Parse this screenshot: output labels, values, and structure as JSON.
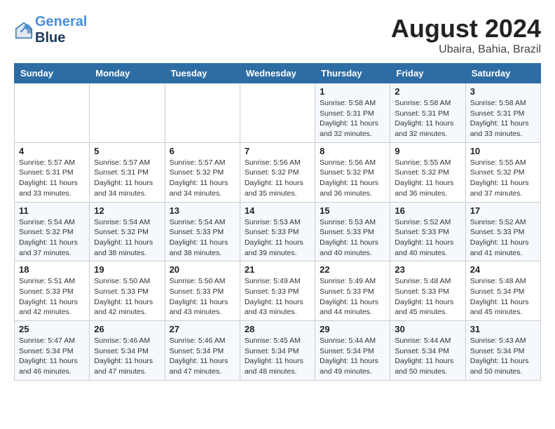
{
  "header": {
    "logo_line1": "General",
    "logo_line2": "Blue",
    "month_year": "August 2024",
    "location": "Ubaira, Bahia, Brazil"
  },
  "days_of_week": [
    "Sunday",
    "Monday",
    "Tuesday",
    "Wednesday",
    "Thursday",
    "Friday",
    "Saturday"
  ],
  "weeks": [
    [
      {
        "day": "",
        "info": ""
      },
      {
        "day": "",
        "info": ""
      },
      {
        "day": "",
        "info": ""
      },
      {
        "day": "",
        "info": ""
      },
      {
        "day": "1",
        "info": "Sunrise: 5:58 AM\nSunset: 5:31 PM\nDaylight: 11 hours and 32 minutes."
      },
      {
        "day": "2",
        "info": "Sunrise: 5:58 AM\nSunset: 5:31 PM\nDaylight: 11 hours and 32 minutes."
      },
      {
        "day": "3",
        "info": "Sunrise: 5:58 AM\nSunset: 5:31 PM\nDaylight: 11 hours and 33 minutes."
      }
    ],
    [
      {
        "day": "4",
        "info": "Sunrise: 5:57 AM\nSunset: 5:31 PM\nDaylight: 11 hours and 33 minutes."
      },
      {
        "day": "5",
        "info": "Sunrise: 5:57 AM\nSunset: 5:31 PM\nDaylight: 11 hours and 34 minutes."
      },
      {
        "day": "6",
        "info": "Sunrise: 5:57 AM\nSunset: 5:32 PM\nDaylight: 11 hours and 34 minutes."
      },
      {
        "day": "7",
        "info": "Sunrise: 5:56 AM\nSunset: 5:32 PM\nDaylight: 11 hours and 35 minutes."
      },
      {
        "day": "8",
        "info": "Sunrise: 5:56 AM\nSunset: 5:32 PM\nDaylight: 11 hours and 36 minutes."
      },
      {
        "day": "9",
        "info": "Sunrise: 5:55 AM\nSunset: 5:32 PM\nDaylight: 11 hours and 36 minutes."
      },
      {
        "day": "10",
        "info": "Sunrise: 5:55 AM\nSunset: 5:32 PM\nDaylight: 11 hours and 37 minutes."
      }
    ],
    [
      {
        "day": "11",
        "info": "Sunrise: 5:54 AM\nSunset: 5:32 PM\nDaylight: 11 hours and 37 minutes."
      },
      {
        "day": "12",
        "info": "Sunrise: 5:54 AM\nSunset: 5:32 PM\nDaylight: 11 hours and 38 minutes."
      },
      {
        "day": "13",
        "info": "Sunrise: 5:54 AM\nSunset: 5:33 PM\nDaylight: 11 hours and 38 minutes."
      },
      {
        "day": "14",
        "info": "Sunrise: 5:53 AM\nSunset: 5:33 PM\nDaylight: 11 hours and 39 minutes."
      },
      {
        "day": "15",
        "info": "Sunrise: 5:53 AM\nSunset: 5:33 PM\nDaylight: 11 hours and 40 minutes."
      },
      {
        "day": "16",
        "info": "Sunrise: 5:52 AM\nSunset: 5:33 PM\nDaylight: 11 hours and 40 minutes."
      },
      {
        "day": "17",
        "info": "Sunrise: 5:52 AM\nSunset: 5:33 PM\nDaylight: 11 hours and 41 minutes."
      }
    ],
    [
      {
        "day": "18",
        "info": "Sunrise: 5:51 AM\nSunset: 5:33 PM\nDaylight: 11 hours and 42 minutes."
      },
      {
        "day": "19",
        "info": "Sunrise: 5:50 AM\nSunset: 5:33 PM\nDaylight: 11 hours and 42 minutes."
      },
      {
        "day": "20",
        "info": "Sunrise: 5:50 AM\nSunset: 5:33 PM\nDaylight: 11 hours and 43 minutes."
      },
      {
        "day": "21",
        "info": "Sunrise: 5:49 AM\nSunset: 5:33 PM\nDaylight: 11 hours and 43 minutes."
      },
      {
        "day": "22",
        "info": "Sunrise: 5:49 AM\nSunset: 5:33 PM\nDaylight: 11 hours and 44 minutes."
      },
      {
        "day": "23",
        "info": "Sunrise: 5:48 AM\nSunset: 5:33 PM\nDaylight: 11 hours and 45 minutes."
      },
      {
        "day": "24",
        "info": "Sunrise: 5:48 AM\nSunset: 5:34 PM\nDaylight: 11 hours and 45 minutes."
      }
    ],
    [
      {
        "day": "25",
        "info": "Sunrise: 5:47 AM\nSunset: 5:34 PM\nDaylight: 11 hours and 46 minutes."
      },
      {
        "day": "26",
        "info": "Sunrise: 5:46 AM\nSunset: 5:34 PM\nDaylight: 11 hours and 47 minutes."
      },
      {
        "day": "27",
        "info": "Sunrise: 5:46 AM\nSunset: 5:34 PM\nDaylight: 11 hours and 47 minutes."
      },
      {
        "day": "28",
        "info": "Sunrise: 5:45 AM\nSunset: 5:34 PM\nDaylight: 11 hours and 48 minutes."
      },
      {
        "day": "29",
        "info": "Sunrise: 5:44 AM\nSunset: 5:34 PM\nDaylight: 11 hours and 49 minutes."
      },
      {
        "day": "30",
        "info": "Sunrise: 5:44 AM\nSunset: 5:34 PM\nDaylight: 11 hours and 50 minutes."
      },
      {
        "day": "31",
        "info": "Sunrise: 5:43 AM\nSunset: 5:34 PM\nDaylight: 11 hours and 50 minutes."
      }
    ]
  ]
}
